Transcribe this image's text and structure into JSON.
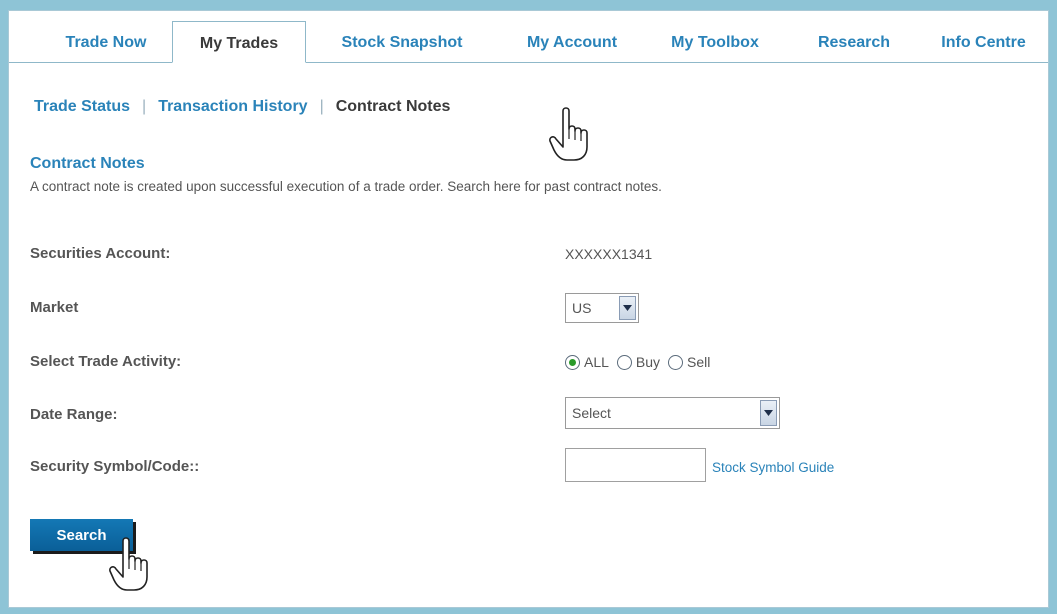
{
  "tabs": [
    {
      "label": "Trade Now",
      "active": false
    },
    {
      "label": "My Trades",
      "active": true
    },
    {
      "label": "Stock Snapshot",
      "active": false
    },
    {
      "label": "My Account",
      "active": false
    },
    {
      "label": "My Toolbox",
      "active": false
    },
    {
      "label": "Research",
      "active": false
    },
    {
      "label": "Info Centre",
      "active": false
    }
  ],
  "subnav": {
    "trade_status": "Trade Status",
    "transaction_history": "Transaction History",
    "contract_notes": "Contract Notes",
    "separator": "|"
  },
  "section": {
    "title": "Contract Notes",
    "description": "A contract note is created upon successful execution of a trade order. Search here for past contract notes."
  },
  "form": {
    "securities_account_label": "Securities Account:",
    "securities_account_value": "XXXXXX1341",
    "market_label": "Market",
    "market_value": "US",
    "trade_activity_label": "Select Trade Activity:",
    "trade_activity_options": [
      "ALL",
      "Buy",
      "Sell"
    ],
    "trade_activity_selected": "ALL",
    "date_range_label": "Date Range:",
    "date_range_value": "Select",
    "symbol_label": "Security Symbol/Code::",
    "symbol_value": "",
    "symbol_guide_link": "Stock Symbol Guide"
  },
  "buttons": {
    "search_label": "Search"
  },
  "colors": {
    "link_blue": "#2a83b9",
    "button_blue": "#0a6aa7",
    "frame_bg": "#8ec4d6",
    "radio_checked": "#2a9a2a"
  }
}
